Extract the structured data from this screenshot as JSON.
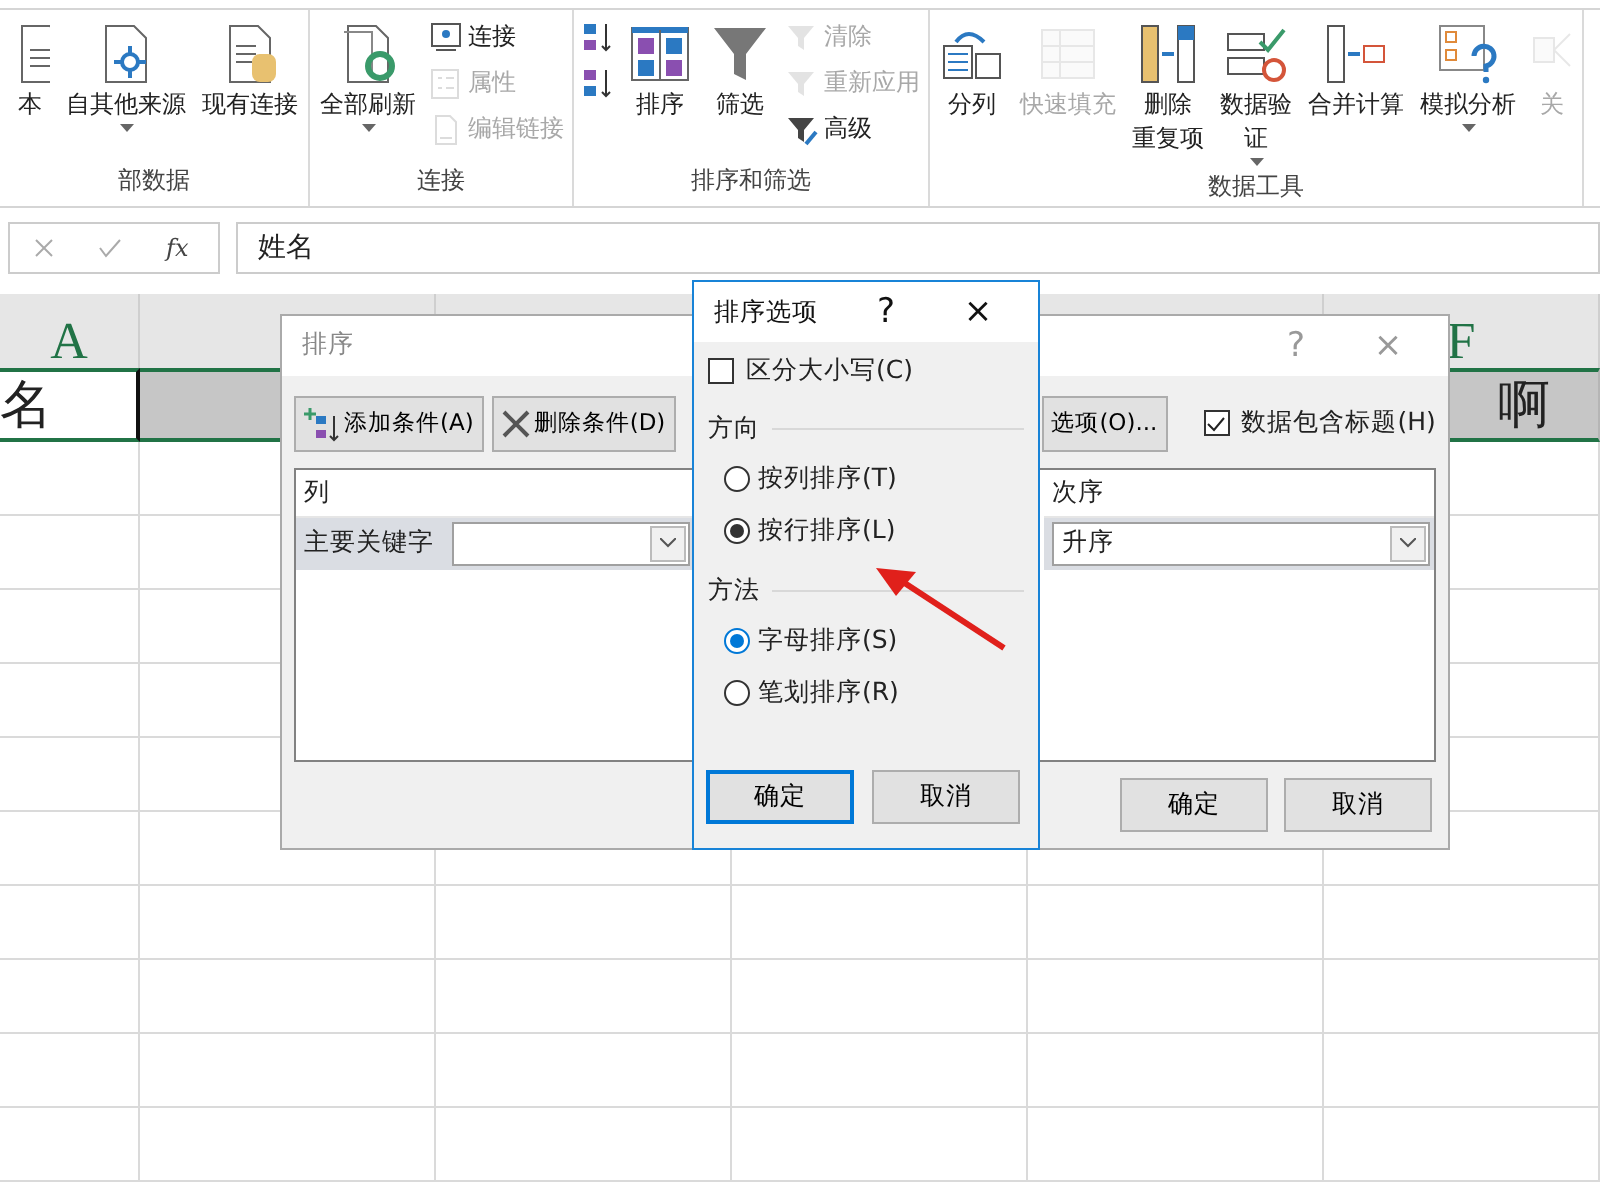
{
  "ribbon": {
    "groups": [
      {
        "label": "部数据",
        "columns": [
          {
            "kind": "large",
            "lines": [
              "本"
            ],
            "disabled": false,
            "dropdown": false
          },
          {
            "kind": "large",
            "lines": [
              "自其他来源"
            ],
            "disabled": false,
            "dropdown": true
          },
          {
            "kind": "large",
            "lines": [
              "现有连接"
            ],
            "disabled": false,
            "dropdown": false
          }
        ]
      },
      {
        "label": "连接",
        "columns": [
          {
            "kind": "large",
            "lines": [
              "全部刷新"
            ],
            "disabled": false,
            "dropdown": true
          },
          {
            "kind": "stack",
            "items": [
              {
                "label": "连接",
                "disabled": false
              },
              {
                "label": "属性",
                "disabled": true
              },
              {
                "label": "编辑链接",
                "disabled": true
              }
            ]
          }
        ]
      },
      {
        "label": "排序和筛选",
        "columns": [
          {
            "kind": "stack",
            "items": [
              {
                "disabled": false
              },
              {
                "disabled": false
              }
            ]
          },
          {
            "kind": "large",
            "lines": [
              "排序"
            ],
            "disabled": false,
            "dropdown": false
          },
          {
            "kind": "large",
            "lines": [
              "筛选"
            ],
            "disabled": false,
            "dropdown": false
          },
          {
            "kind": "stack",
            "items": [
              {
                "label": "清除",
                "disabled": true
              },
              {
                "label": "重新应用",
                "disabled": true
              },
              {
                "label": "高级",
                "disabled": false
              }
            ]
          }
        ]
      },
      {
        "label": "数据工具",
        "columns": [
          {
            "kind": "large",
            "lines": [
              "分列"
            ],
            "disabled": false,
            "dropdown": false
          },
          {
            "kind": "large",
            "lines": [
              "快速填充"
            ],
            "disabled": true,
            "dropdown": false
          },
          {
            "kind": "large",
            "lines": [
              "删除",
              "重复项"
            ],
            "disabled": false,
            "dropdown": false
          },
          {
            "kind": "large",
            "lines": [
              "数据验",
              "证"
            ],
            "disabled": false,
            "dropdown": true
          },
          {
            "kind": "large",
            "lines": [
              "合并计算"
            ],
            "disabled": false,
            "dropdown": false
          },
          {
            "kind": "large",
            "lines": [
              "模拟分析"
            ],
            "disabled": false,
            "dropdown": true
          },
          {
            "kind": "large",
            "lines": [
              "关"
            ],
            "disabled": true,
            "dropdown": false
          }
        ]
      }
    ]
  },
  "formula_bar": {
    "function_label": "fx",
    "value": "姓名"
  },
  "grid": {
    "columns": [
      {
        "header": "A"
      },
      {},
      {},
      {},
      {},
      {
        "header": "F"
      }
    ],
    "row_1_left": [
      {
        "value": "名",
        "active": true
      },
      {
        "active": false
      }
    ],
    "row_1_right": [
      {
        "value": "啊",
        "active": false
      }
    ]
  },
  "sort_dialog": {
    "title": "排序",
    "help": "?",
    "close": "×",
    "add_button": "添加条件(A)",
    "delete_button": "删除条件(D)",
    "options_button": "选项(O)...",
    "header_checkbox": {
      "label": "数据包含标题(H)",
      "checked": true
    },
    "column_header": "列",
    "key_label": "主要关键字",
    "order_header": "次序",
    "order_value": "升序",
    "ok": "确定",
    "cancel": "取消"
  },
  "options_dialog": {
    "title": "排序选项",
    "help": "?",
    "close": "×",
    "case_checkbox": {
      "label": "区分大小写(C)",
      "checked": false
    },
    "direction_label": "方向",
    "direction": [
      {
        "label": "按列排序(T)",
        "selected": false
      },
      {
        "label": "按行排序(L)",
        "selected": true
      }
    ],
    "method_label": "方法",
    "method": [
      {
        "label": "字母排序(S)",
        "selected": true
      },
      {
        "label": "笔划排序(R)",
        "selected": false
      }
    ],
    "ok": "确定",
    "cancel": "取消"
  }
}
